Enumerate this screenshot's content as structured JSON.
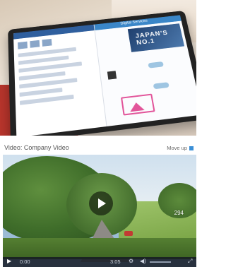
{
  "photo": {
    "screen_header": "Digital Services",
    "banner_text": "JAPAN'S NO.1"
  },
  "video": {
    "title": "Video: Company Video",
    "move_up_label": "Move up"
  },
  "player": {
    "overlay_number": "294",
    "current_time": "0:00",
    "total_time": "3:05",
    "play_icon": "play-icon",
    "gear_icon": "gear-icon",
    "volume_icon": "volume-icon",
    "fullscreen_icon": "fullscreen-icon"
  },
  "colors": {
    "accent": "#3b8fd6",
    "controls_bg": "#141923"
  }
}
